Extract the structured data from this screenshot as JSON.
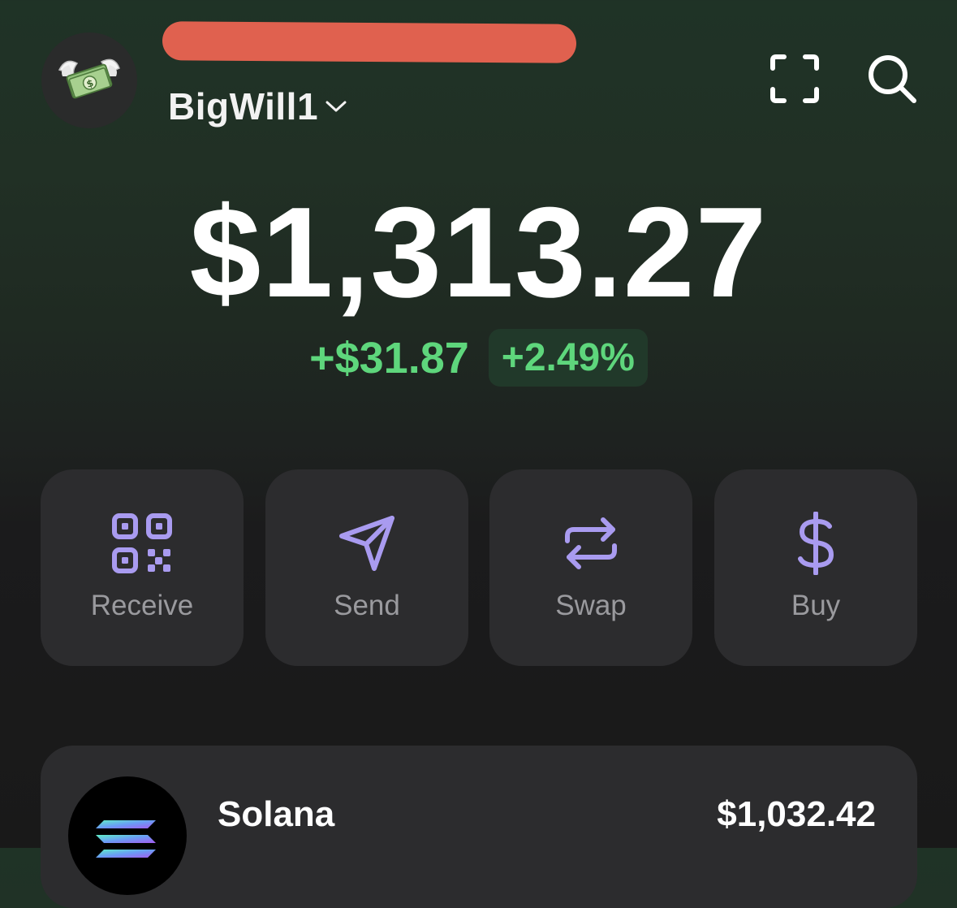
{
  "header": {
    "account_name": "BigWill1",
    "avatar_icon": "money-with-wings-icon",
    "redaction_color": "#e0614f",
    "scan_icon": "scan-icon",
    "search_icon": "search-icon"
  },
  "balance": {
    "total": "$1,313.27",
    "change_amount": "+$31.87",
    "change_percent": "+2.49%",
    "positive_color": "#5ed67c"
  },
  "actions": [
    {
      "label": "Receive",
      "icon": "qr-code-icon"
    },
    {
      "label": "Send",
      "icon": "paper-plane-icon"
    },
    {
      "label": "Swap",
      "icon": "swap-arrows-icon"
    },
    {
      "label": "Buy",
      "icon": "dollar-sign-icon"
    }
  ],
  "accent_color": "#a99bf0",
  "tokens": [
    {
      "name": "Solana",
      "value": "$1,032.42",
      "icon": "solana-logo-icon"
    }
  ]
}
